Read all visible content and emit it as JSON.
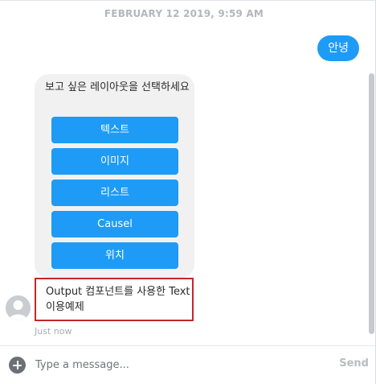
{
  "conversation": {
    "timestamp": "FEBRUARY 12 2019, 9:59 AM"
  },
  "user_message": {
    "text": "안녕"
  },
  "bot_card": {
    "prompt": "보고 싶은 레이아웃을 선택하세요",
    "buttons": [
      {
        "label": "텍스트"
      },
      {
        "label": "이미지"
      },
      {
        "label": "리스트"
      },
      {
        "label": "Causel"
      },
      {
        "label": "위치"
      }
    ]
  },
  "bot_message": {
    "text": "Output 컴포넌트를 사용한 Text 이용예제",
    "status": "Just now"
  },
  "composer": {
    "placeholder": "Type a message...",
    "send_label": "Send"
  },
  "colors": {
    "accent": "#1e9bf6",
    "highlight_border": "#c4262e",
    "bubble_gray": "#f1f1f2"
  },
  "icons": {
    "add": "plus-circle-icon",
    "avatar": "user-avatar-icon"
  }
}
